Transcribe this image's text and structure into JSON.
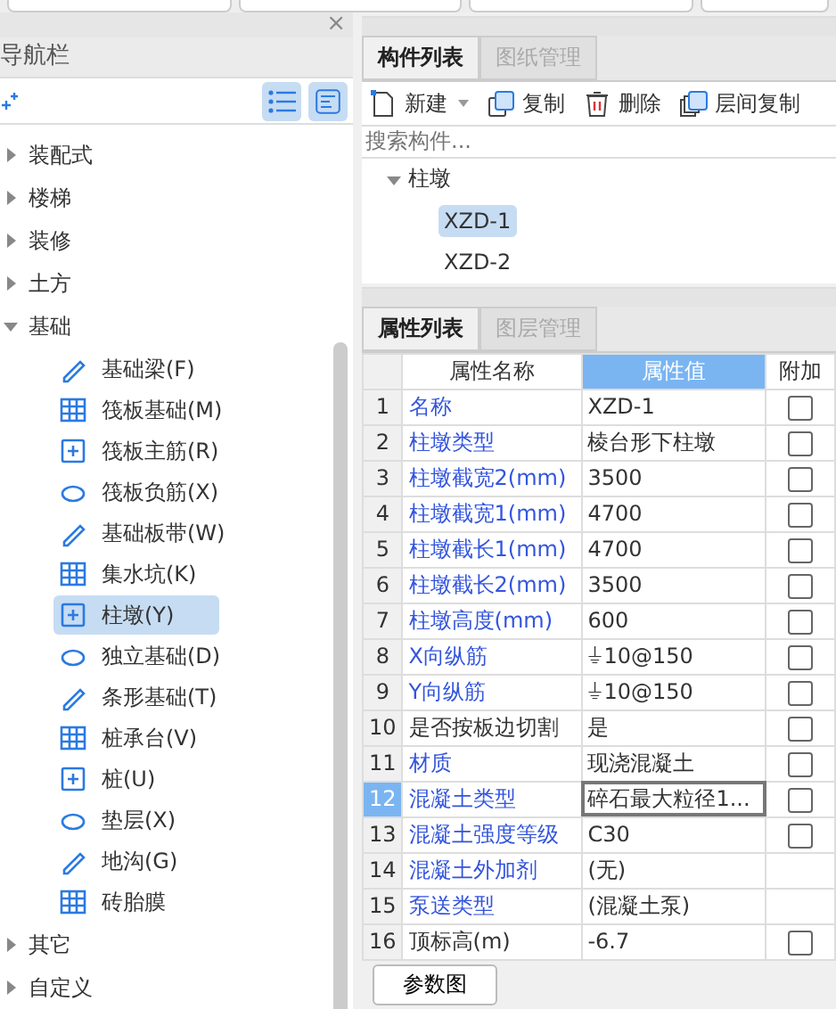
{
  "nav": {
    "title": "导航栏",
    "close": "×",
    "tree": [
      {
        "label": "装配式",
        "expanded": false
      },
      {
        "label": "楼梯",
        "expanded": false
      },
      {
        "label": "装修",
        "expanded": false
      },
      {
        "label": "土方",
        "expanded": false
      },
      {
        "label": "基础",
        "expanded": true,
        "children": [
          {
            "label": "基础梁(F)",
            "selected": false
          },
          {
            "label": "筏板基础(M)",
            "selected": false
          },
          {
            "label": "筏板主筋(R)",
            "selected": false
          },
          {
            "label": "筏板负筋(X)",
            "selected": false
          },
          {
            "label": "基础板带(W)",
            "selected": false
          },
          {
            "label": "集水坑(K)",
            "selected": false
          },
          {
            "label": "柱墩(Y)",
            "selected": true
          },
          {
            "label": "独立基础(D)",
            "selected": false
          },
          {
            "label": "条形基础(T)",
            "selected": false
          },
          {
            "label": "桩承台(V)",
            "selected": false
          },
          {
            "label": "桩(U)",
            "selected": false
          },
          {
            "label": "垫层(X)",
            "selected": false
          },
          {
            "label": "地沟(G)",
            "selected": false
          },
          {
            "label": "砖胎膜",
            "selected": false
          }
        ]
      },
      {
        "label": "其它",
        "expanded": false
      },
      {
        "label": "自定义",
        "expanded": false
      }
    ]
  },
  "components": {
    "tabs": [
      {
        "label": "构件列表",
        "selected": true
      },
      {
        "label": "图纸管理",
        "selected": false
      }
    ],
    "toolbar": [
      {
        "label": "新建",
        "kind": "new"
      },
      {
        "label": "复制",
        "kind": "copy"
      },
      {
        "label": "删除",
        "kind": "delete"
      },
      {
        "label": "层间复制",
        "kind": "floorcopy"
      }
    ],
    "search": {
      "placeholder": "搜索构件..."
    },
    "tree": {
      "label": "柱墩",
      "expanded": true,
      "children": [
        {
          "label": "XZD-1",
          "selected": true
        },
        {
          "label": "XZD-2",
          "selected": false
        }
      ]
    }
  },
  "properties": {
    "tabs": [
      {
        "label": "属性列表",
        "selected": true
      },
      {
        "label": "图层管理",
        "selected": false
      }
    ],
    "columns": [
      "属性名称",
      "属性值",
      "附加"
    ],
    "rows": [
      {
        "index": "1",
        "name": "名称",
        "value": "XZD-1",
        "public": true,
        "selected": false,
        "checked": false
      },
      {
        "index": "2",
        "name": "柱墩类型",
        "value": "棱台形下柱墩",
        "public": true,
        "selected": false,
        "checked": false
      },
      {
        "index": "3",
        "name": "柱墩截宽2(mm)",
        "value": "3500",
        "public": true,
        "selected": false,
        "checked": false
      },
      {
        "index": "4",
        "name": "柱墩截宽1(mm)",
        "value": "4700",
        "public": true,
        "selected": false,
        "checked": false
      },
      {
        "index": "5",
        "name": "柱墩截长1(mm)",
        "value": "4700",
        "public": true,
        "selected": false,
        "checked": false
      },
      {
        "index": "6",
        "name": "柱墩截长2(mm)",
        "value": "3500",
        "public": true,
        "selected": false,
        "checked": false
      },
      {
        "index": "7",
        "name": "柱墩高度(mm)",
        "value": "600",
        "public": true,
        "selected": false,
        "checked": false
      },
      {
        "index": "8",
        "name": "X向纵筋",
        "value": "⏚10@150",
        "public": true,
        "selected": false,
        "checked": false
      },
      {
        "index": "9",
        "name": "Y向纵筋",
        "value": "⏚10@150",
        "public": true,
        "selected": false,
        "checked": false
      },
      {
        "index": "10",
        "name": "是否按板边切割",
        "value": "是",
        "public": false,
        "selected": false,
        "checked": false
      },
      {
        "index": "11",
        "name": "材质",
        "value": "现浇混凝土",
        "public": true,
        "selected": false,
        "checked": false
      },
      {
        "index": "12",
        "name": "混凝土类型",
        "value": "碎石最大粒径1...",
        "public": true,
        "selected": true,
        "checked": false
      },
      {
        "index": "13",
        "name": "混凝土强度等级",
        "value": "C30",
        "public": true,
        "selected": false,
        "checked": false
      },
      {
        "index": "14",
        "name": "混凝土外加剂",
        "value": "(无)",
        "public": true,
        "selected": false
      },
      {
        "index": "15",
        "name": "泵送类型",
        "value": "(混凝土泵)",
        "public": true,
        "selected": false
      },
      {
        "index": "16",
        "name": "顶标高(m)",
        "value": "-6.7",
        "public": false,
        "selected": false,
        "checked": false
      }
    ],
    "button": "参数图"
  }
}
